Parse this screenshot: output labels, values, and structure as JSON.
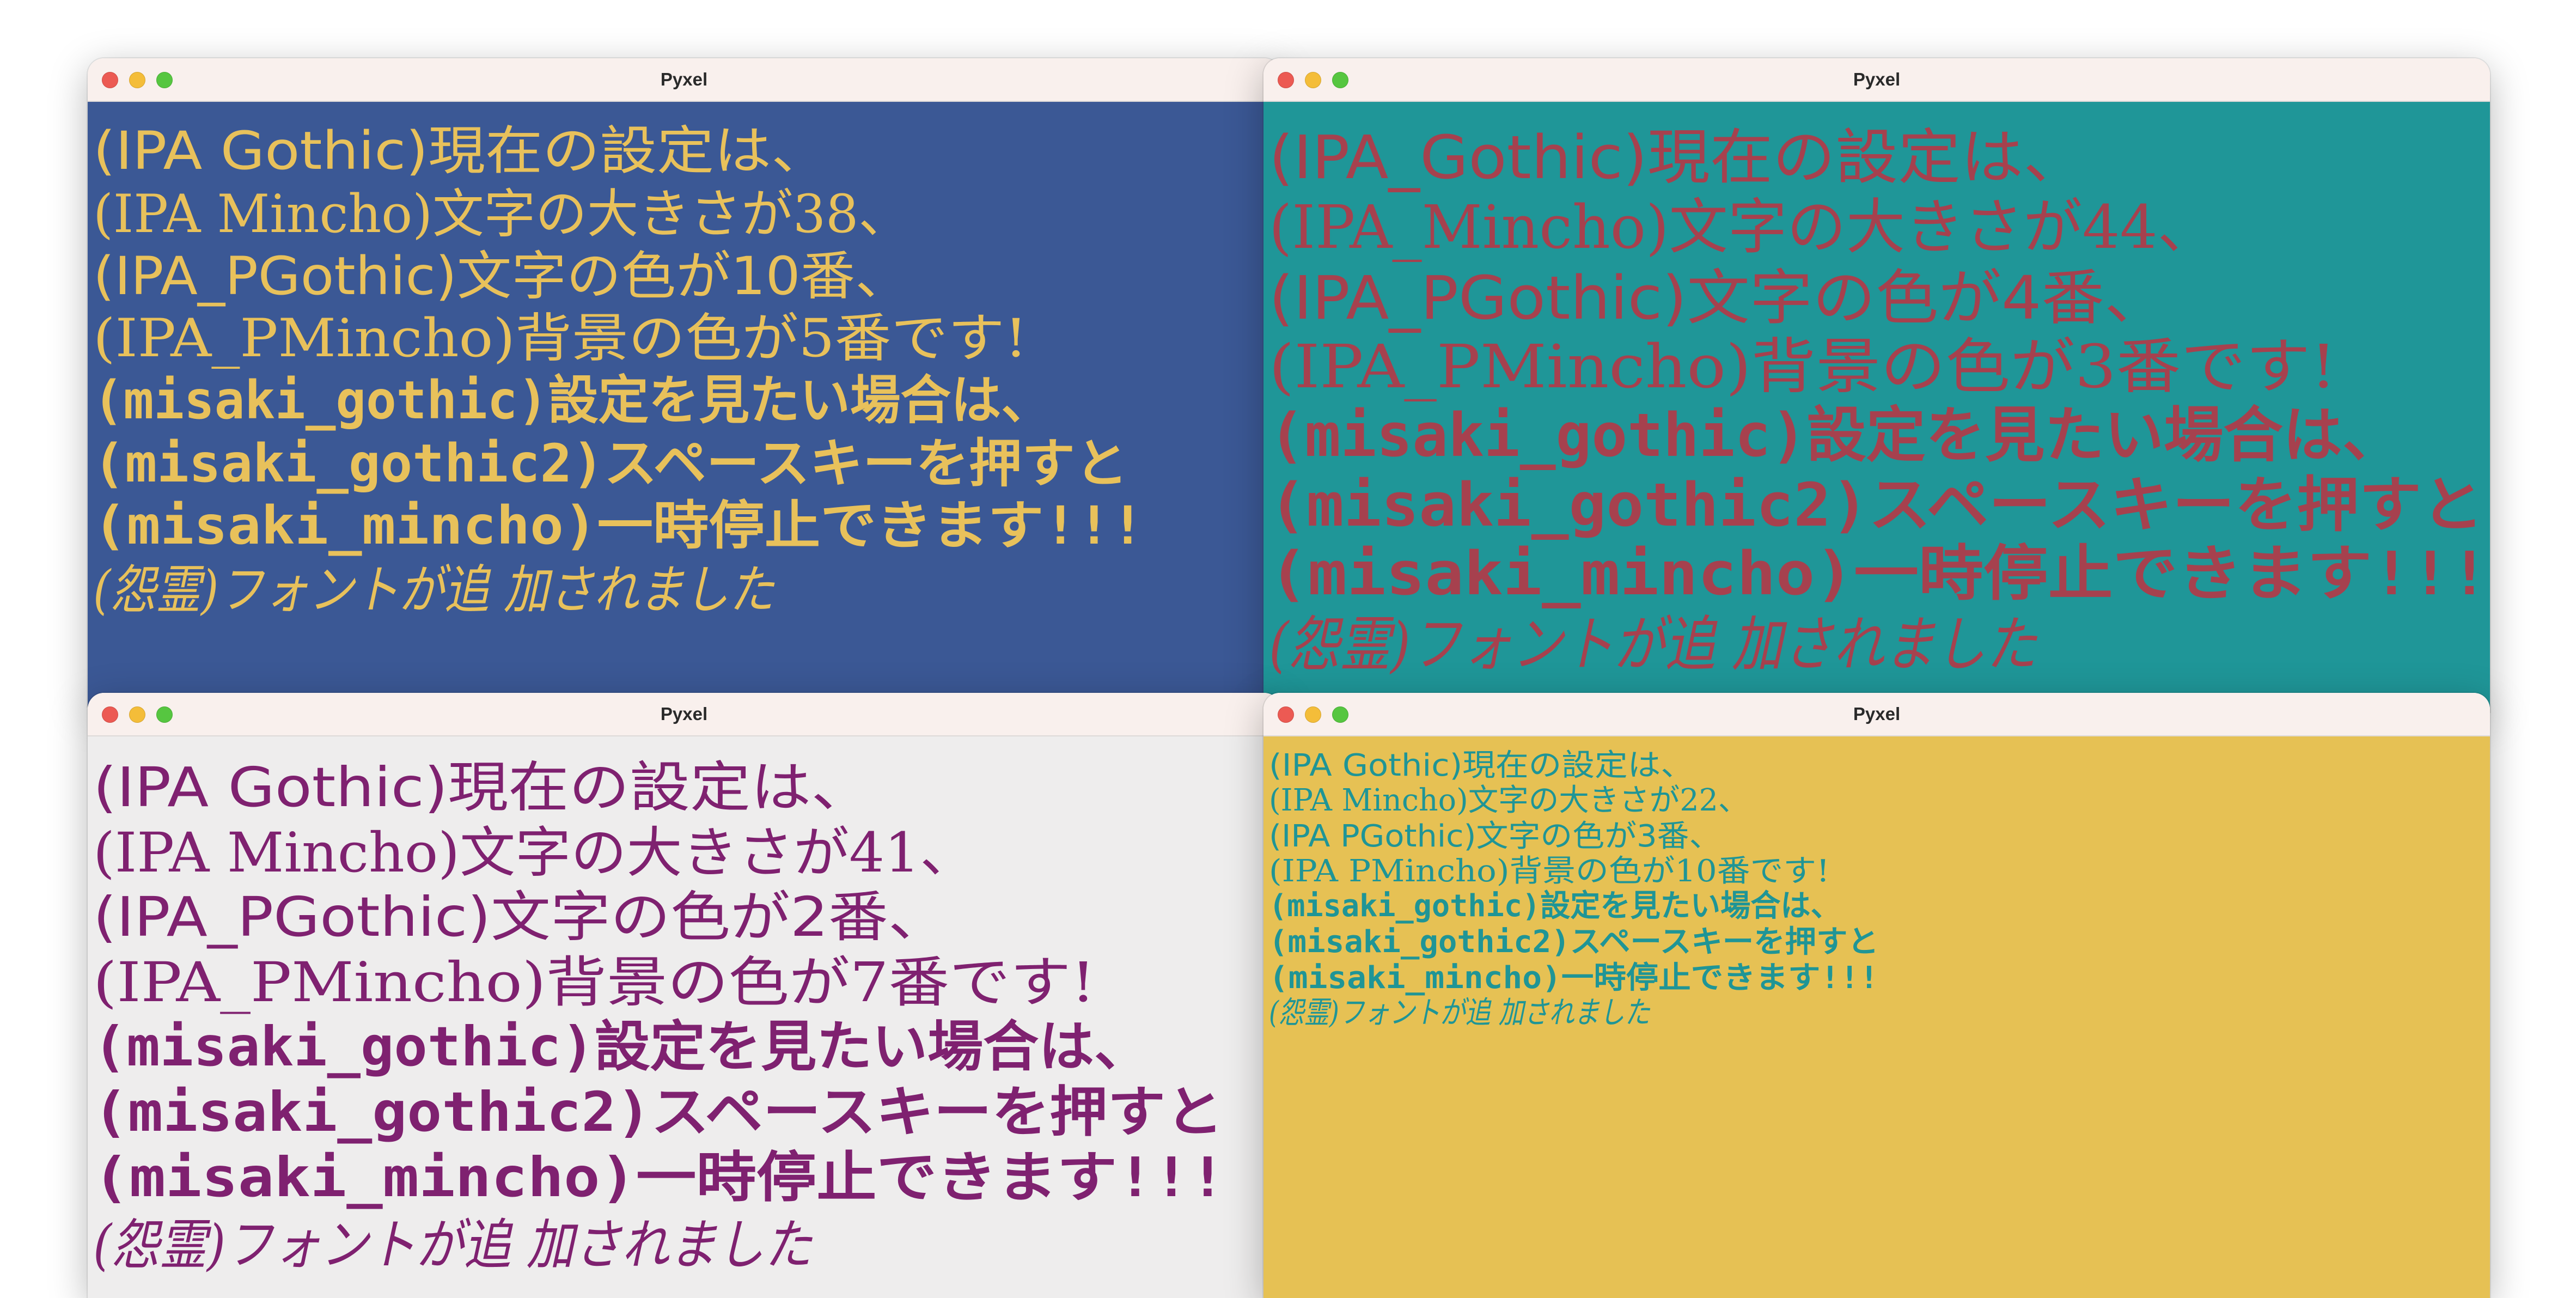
{
  "windows": [
    {
      "id": "top-left",
      "title": "Pyxel",
      "bg": "#3b5895",
      "fg": "#e8c15b",
      "lines": [
        "(IPA Gothic)現在の設定は、",
        "(IPA Mincho)文字の大きさが38、",
        "(IPA_PGothic)文字の色が10番、",
        "(IPA_PMincho)背景の色が5番です!",
        "(misaki_gothic)設定を見たい場合は、",
        "(misaki_gothic2)スペースキーを押すと",
        "(misaki_mincho)一時停止できます!!!",
        "(怨霊)フォントが追 加されました"
      ]
    },
    {
      "id": "top-right",
      "title": "Pyxel",
      "bg": "#1f9698",
      "fg": "#a6414e",
      "lines": [
        "(IPA_Gothic)現在の設定は、",
        "(IPA_Mincho)文字の大きさが44、",
        "(IPA_PGothic)文字の色が4番、",
        "(IPA_PMincho)背景の色が3番です!",
        "(misaki_gothic)設定を見たい場合は、",
        "(misaki_gothic2)スペースキーを押すと",
        "(misaki_mincho)一時停止できます!!!",
        "(怨霊)フォントが追 加されました"
      ]
    },
    {
      "id": "bottom-left",
      "title": "Pyxel",
      "bg": "#eeeded",
      "fg": "#7f2170",
      "lines": [
        "(IPA Gothic)現在の設定は、",
        "(IPA Mincho)文字の大きさが41、",
        "(IPA_PGothic)文字の色が2番、",
        "(IPA_PMincho)背景の色が7番です!",
        "(misaki_gothic)設定を見たい場合は、",
        "(misaki_gothic2)スペースキーを押すと",
        "(misaki_mincho)一時停止できます!!!",
        "(怨霊)フォントが追 加されました"
      ]
    },
    {
      "id": "bottom-right",
      "title": "Pyxel",
      "bg": "#e6c154",
      "fg": "#1f9596",
      "lines": [
        "(IPA Gothic)現在の設定は、",
        "(IPA Mincho)文字の大きさが22、",
        "(IPA PGothic)文字の色が3番、",
        "(IPA PMincho)背景の色が10番です!",
        "(misaki_gothic)設定を見たい場合は、",
        "(misaki_gothic2)スペースキーを押すと",
        "(misaki_mincho)一時停止できます!!!",
        "(怨霊)フォントが追 加されました"
      ]
    }
  ]
}
